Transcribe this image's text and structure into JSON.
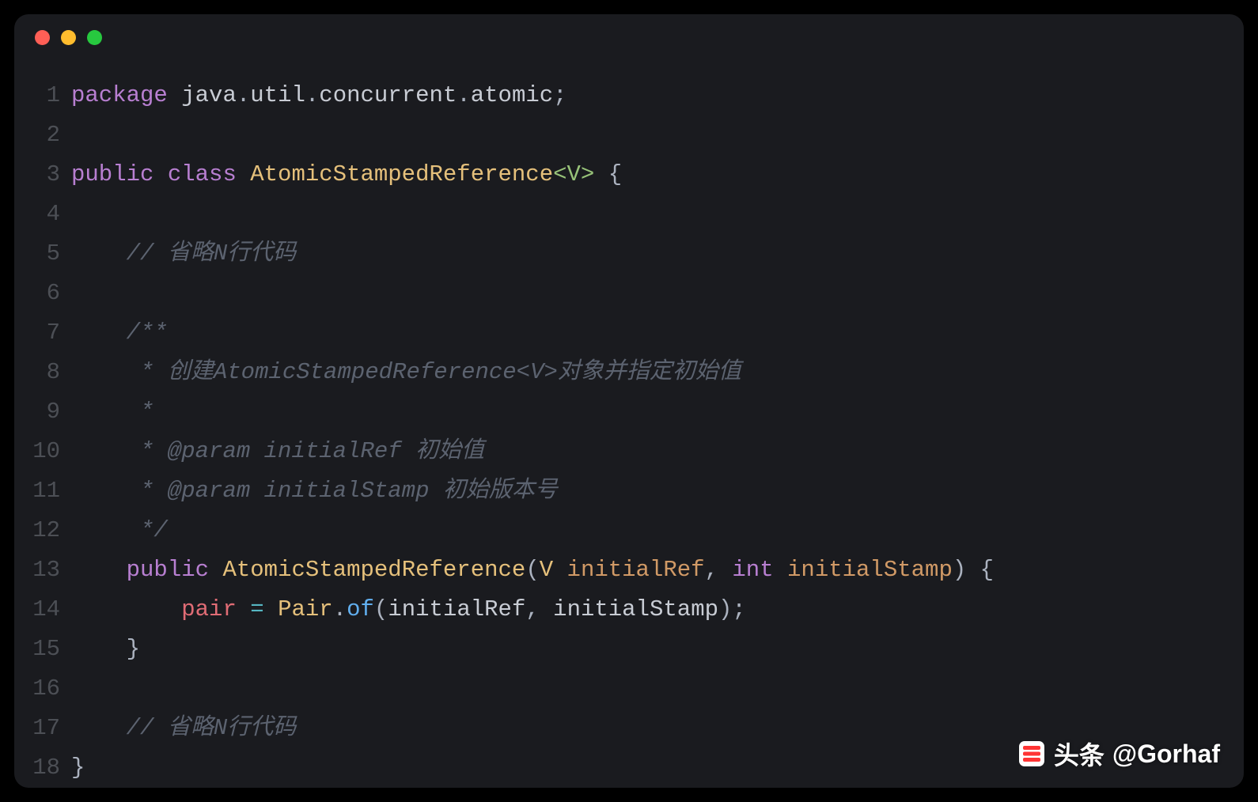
{
  "window": {
    "traffic_lights": [
      "close",
      "minimize",
      "zoom"
    ]
  },
  "watermark": {
    "prefix": "头条",
    "handle": "@Gorhaf"
  },
  "code": {
    "lines": [
      {
        "n": 1,
        "tokens": [
          {
            "c": "tok-kw",
            "t": "package"
          },
          {
            "c": "",
            "t": " "
          },
          {
            "c": "tok-pkg",
            "t": "java"
          },
          {
            "c": "tok-punc",
            "t": "."
          },
          {
            "c": "tok-pkg",
            "t": "util"
          },
          {
            "c": "tok-punc",
            "t": "."
          },
          {
            "c": "tok-pkg",
            "t": "concurrent"
          },
          {
            "c": "tok-punc",
            "t": "."
          },
          {
            "c": "tok-pkg",
            "t": "atomic"
          },
          {
            "c": "tok-punc",
            "t": ";"
          }
        ]
      },
      {
        "n": 2,
        "tokens": []
      },
      {
        "n": 3,
        "tokens": [
          {
            "c": "tok-kw",
            "t": "public"
          },
          {
            "c": "",
            "t": " "
          },
          {
            "c": "tok-kw",
            "t": "class"
          },
          {
            "c": "",
            "t": " "
          },
          {
            "c": "tok-type",
            "t": "AtomicStampedReference"
          },
          {
            "c": "tok-generic",
            "t": "<V>"
          },
          {
            "c": "",
            "t": " "
          },
          {
            "c": "tok-punc",
            "t": "{"
          }
        ]
      },
      {
        "n": 4,
        "tokens": []
      },
      {
        "n": 5,
        "tokens": [
          {
            "c": "",
            "t": "    "
          },
          {
            "c": "tok-comment",
            "t": "// 省略N行代码"
          }
        ]
      },
      {
        "n": 6,
        "tokens": []
      },
      {
        "n": 7,
        "tokens": [
          {
            "c": "",
            "t": "    "
          },
          {
            "c": "tok-comment",
            "t": "/**"
          }
        ]
      },
      {
        "n": 8,
        "tokens": [
          {
            "c": "",
            "t": "     "
          },
          {
            "c": "tok-comment",
            "t": "* 创建AtomicStampedReference<V>对象并指定初始值"
          }
        ]
      },
      {
        "n": 9,
        "tokens": [
          {
            "c": "",
            "t": "     "
          },
          {
            "c": "tok-comment",
            "t": "*"
          }
        ]
      },
      {
        "n": 10,
        "tokens": [
          {
            "c": "",
            "t": "     "
          },
          {
            "c": "tok-comment",
            "t": "* "
          },
          {
            "c": "tok-doctag",
            "t": "@param"
          },
          {
            "c": "tok-comment",
            "t": " initialRef 初始值"
          }
        ]
      },
      {
        "n": 11,
        "tokens": [
          {
            "c": "",
            "t": "     "
          },
          {
            "c": "tok-comment",
            "t": "* "
          },
          {
            "c": "tok-doctag",
            "t": "@param"
          },
          {
            "c": "tok-comment",
            "t": " initialStamp 初始版本号"
          }
        ]
      },
      {
        "n": 12,
        "tokens": [
          {
            "c": "",
            "t": "     "
          },
          {
            "c": "tok-comment",
            "t": "*/"
          }
        ]
      },
      {
        "n": 13,
        "tokens": [
          {
            "c": "",
            "t": "    "
          },
          {
            "c": "tok-kw",
            "t": "public"
          },
          {
            "c": "",
            "t": " "
          },
          {
            "c": "tok-type",
            "t": "AtomicStampedReference"
          },
          {
            "c": "tok-punc",
            "t": "("
          },
          {
            "c": "tok-type",
            "t": "V"
          },
          {
            "c": "",
            "t": " "
          },
          {
            "c": "tok-param",
            "t": "initialRef"
          },
          {
            "c": "tok-punc",
            "t": ","
          },
          {
            "c": "",
            "t": " "
          },
          {
            "c": "tok-int",
            "t": "int"
          },
          {
            "c": "",
            "t": " "
          },
          {
            "c": "tok-param",
            "t": "initialStamp"
          },
          {
            "c": "tok-punc",
            "t": ")"
          },
          {
            "c": "",
            "t": " "
          },
          {
            "c": "tok-punc",
            "t": "{"
          }
        ]
      },
      {
        "n": 14,
        "tokens": [
          {
            "c": "",
            "t": "        "
          },
          {
            "c": "tok-field",
            "t": "pair"
          },
          {
            "c": "",
            "t": " "
          },
          {
            "c": "tok-op",
            "t": "="
          },
          {
            "c": "",
            "t": " "
          },
          {
            "c": "tok-type",
            "t": "Pair"
          },
          {
            "c": "tok-punc",
            "t": "."
          },
          {
            "c": "tok-method",
            "t": "of"
          },
          {
            "c": "tok-punc",
            "t": "("
          },
          {
            "c": "tok-pkg",
            "t": "initialRef"
          },
          {
            "c": "tok-punc",
            "t": ","
          },
          {
            "c": "",
            "t": " "
          },
          {
            "c": "tok-pkg",
            "t": "initialStamp"
          },
          {
            "c": "tok-punc",
            "t": ")"
          },
          {
            "c": "tok-punc",
            "t": ";"
          }
        ]
      },
      {
        "n": 15,
        "tokens": [
          {
            "c": "",
            "t": "    "
          },
          {
            "c": "tok-punc",
            "t": "}"
          }
        ]
      },
      {
        "n": 16,
        "tokens": []
      },
      {
        "n": 17,
        "tokens": [
          {
            "c": "",
            "t": "    "
          },
          {
            "c": "tok-comment",
            "t": "// 省略N行代码"
          }
        ]
      },
      {
        "n": 18,
        "tokens": [
          {
            "c": "tok-punc",
            "t": "}"
          }
        ]
      }
    ]
  }
}
